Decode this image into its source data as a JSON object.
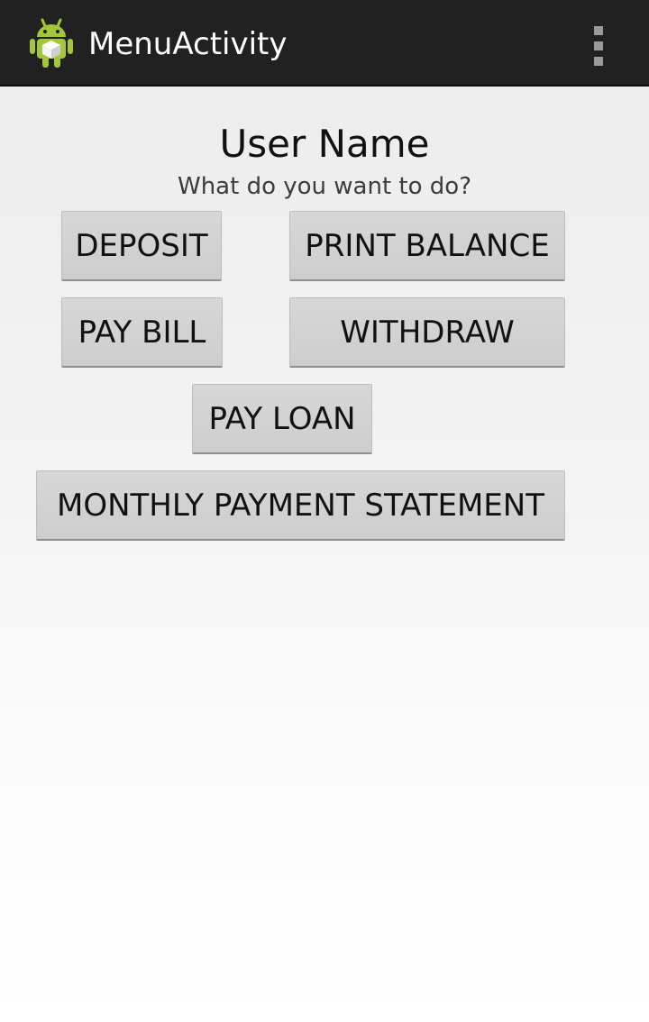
{
  "action_bar": {
    "title": "MenuActivity",
    "app_icon": "android-robot-icon",
    "overflow_icon": "overflow-menu-icon",
    "background_color": "#212121"
  },
  "main": {
    "user_name": "User Name",
    "prompt": "What do you want to do?",
    "buttons": {
      "deposit": "DEPOSIT",
      "print_balance": "PRINT BALANCE",
      "pay_bill": "PAY BILL",
      "withdraw": "WITHDRAW",
      "pay_loan": "PAY LOAN",
      "monthly_statement": "MONTHLY PAYMENT STATEMENT"
    },
    "button_color": "#cfcfcf"
  }
}
